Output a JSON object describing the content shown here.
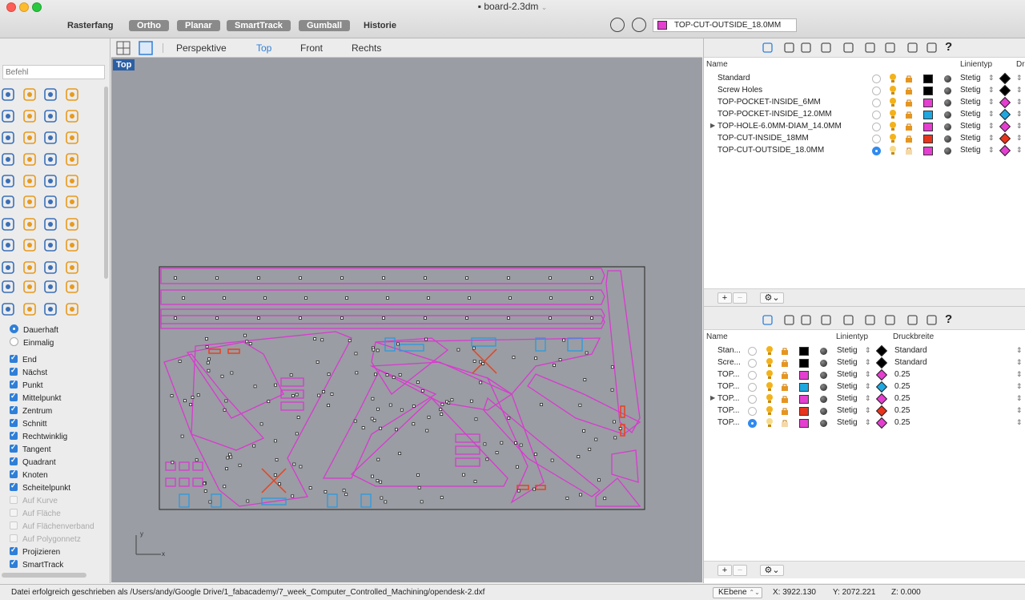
{
  "window": {
    "title": "board-2.3dm",
    "title_chevron": "⌄"
  },
  "statusbar_top": {
    "rasterfang": "Rasterfang",
    "ortho": "Ortho",
    "planar": "Planar",
    "smarttrack": "SmartTrack",
    "gumball": "Gumball",
    "historie": "Historie",
    "current_layer": "TOP-CUT-OUTSIDE_18.0MM",
    "current_layer_color": "#e43fd0"
  },
  "command": {
    "placeholder": "Befehl"
  },
  "osnap": {
    "dauerhaft": "Dauerhaft",
    "einmalig": "Einmalig",
    "items": [
      {
        "label": "End",
        "checked": true
      },
      {
        "label": "Nächst",
        "checked": true
      },
      {
        "label": "Punkt",
        "checked": true
      },
      {
        "label": "Mittelpunkt",
        "checked": true
      },
      {
        "label": "Zentrum",
        "checked": true
      },
      {
        "label": "Schnitt",
        "checked": true
      },
      {
        "label": "Rechtwinklig",
        "checked": true
      },
      {
        "label": "Tangent",
        "checked": true
      },
      {
        "label": "Quadrant",
        "checked": true
      },
      {
        "label": "Knoten",
        "checked": true
      },
      {
        "label": "Scheitelpunkt",
        "checked": true
      },
      {
        "label": "Auf Kurve",
        "checked": false
      },
      {
        "label": "Auf Fläche",
        "checked": false
      },
      {
        "label": "Auf Flächenverband",
        "checked": false
      },
      {
        "label": "Auf Polygonnetz",
        "checked": false
      },
      {
        "label": "Projizieren",
        "checked": true
      },
      {
        "label": "SmartTrack",
        "checked": true
      }
    ]
  },
  "viewport_tabs": {
    "perspektive": "Perspektive",
    "top": "Top",
    "front": "Front",
    "rechts": "Rechts",
    "active_label": "Top"
  },
  "axes": {
    "x": "x",
    "y": "y"
  },
  "layers_top": {
    "col_name": "Name",
    "col_linetype": "Linientyp",
    "col_print": "Dr",
    "rows": [
      {
        "name": "Standard",
        "color": "#000000",
        "linetype": "Stetig",
        "print_color": "#000000",
        "current": false,
        "expandable": false
      },
      {
        "name": "Screw Holes",
        "color": "#000000",
        "linetype": "Stetig",
        "print_color": "#000000",
        "current": false,
        "expandable": false
      },
      {
        "name": "TOP-POCKET-INSIDE_6MM",
        "color": "#e43fd0",
        "linetype": "Stetig",
        "print_color": "#e43fd0",
        "current": false,
        "expandable": false
      },
      {
        "name": "TOP-POCKET-INSIDE_12.0MM",
        "color": "#1fa8e0",
        "linetype": "Stetig",
        "print_color": "#1fa8e0",
        "current": false,
        "expandable": false
      },
      {
        "name": "TOP-HOLE-6.0MM-DIAM_14.0MM",
        "color": "#e43fd0",
        "linetype": "Stetig",
        "print_color": "#e43fd0",
        "current": false,
        "expandable": true
      },
      {
        "name": "TOP-CUT-INSIDE_18MM",
        "color": "#e8341c",
        "linetype": "Stetig",
        "print_color": "#e8341c",
        "current": false,
        "expandable": false
      },
      {
        "name": "TOP-CUT-OUTSIDE_18.0MM",
        "color": "#e43fd0",
        "linetype": "Stetig",
        "print_color": "#e43fd0",
        "current": true,
        "expandable": false
      }
    ]
  },
  "layers_bottom": {
    "col_name": "Name",
    "col_linetype": "Linientyp",
    "col_print": "Druckbreite",
    "rows": [
      {
        "name": "Stan...",
        "color": "#000000",
        "linetype": "Stetig",
        "print_color": "#000000",
        "width": "Standard",
        "current": false,
        "expandable": false
      },
      {
        "name": "Scre...",
        "color": "#000000",
        "linetype": "Stetig",
        "print_color": "#000000",
        "width": "Standard",
        "current": false,
        "expandable": false
      },
      {
        "name": "TOP...",
        "color": "#e43fd0",
        "linetype": "Stetig",
        "print_color": "#e43fd0",
        "width": "0.25",
        "current": false,
        "expandable": false
      },
      {
        "name": "TOP...",
        "color": "#1fa8e0",
        "linetype": "Stetig",
        "print_color": "#1fa8e0",
        "width": "0.25",
        "current": false,
        "expandable": false
      },
      {
        "name": "TOP...",
        "color": "#e43fd0",
        "linetype": "Stetig",
        "print_color": "#e43fd0",
        "width": "0.25",
        "current": false,
        "expandable": true
      },
      {
        "name": "TOP...",
        "color": "#e8341c",
        "linetype": "Stetig",
        "print_color": "#e8341c",
        "width": "0.25",
        "current": false,
        "expandable": false
      },
      {
        "name": "TOP...",
        "color": "#e43fd0",
        "linetype": "Stetig",
        "print_color": "#e43fd0",
        "width": "0.25",
        "current": true,
        "expandable": false
      }
    ]
  },
  "buttons": {
    "add": "+",
    "remove": "−",
    "gear": "⚙",
    "gear_chevron": "⌄",
    "help": "?"
  },
  "statusbar": {
    "message": "Datei erfolgreich geschrieben als /Users/andy/Google Drive/1_fabacademy/7_week_Computer_Controlled_Machining/opendesk-2.dxf",
    "cplane": "KEbene",
    "x": "X: 3922.130",
    "y": "Y: 2072.221",
    "z": "Z: 0.000"
  }
}
